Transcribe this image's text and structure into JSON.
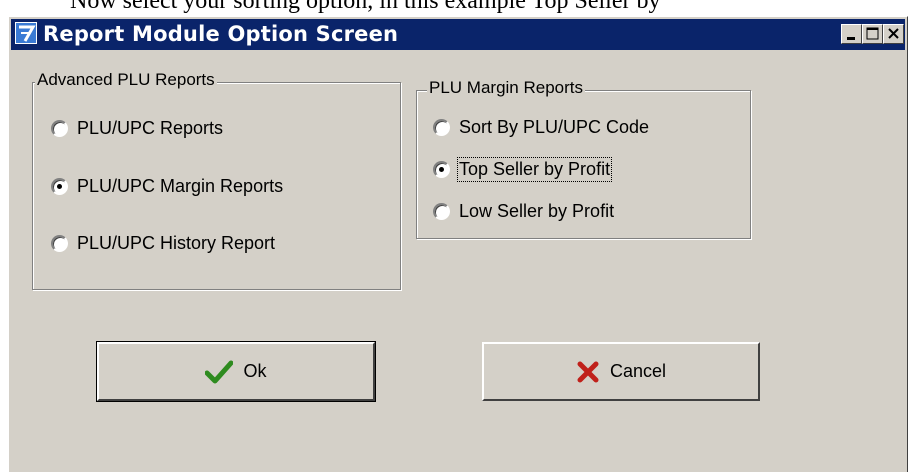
{
  "page_caption": "Now select your sorting option, in this example Top Seller by",
  "window": {
    "title": "Report Module Option Screen",
    "app_icon": "7-app-icon",
    "controls": [
      "minimize-icon",
      "maximize-icon",
      "close-icon"
    ]
  },
  "advanced_group": {
    "title": "Advanced PLU Reports",
    "options": [
      {
        "label": "PLU/UPC Reports",
        "checked": false
      },
      {
        "label": "PLU/UPC Margin Reports",
        "checked": true
      },
      {
        "label": "PLU/UPC History Report",
        "checked": false
      }
    ]
  },
  "margin_group": {
    "title": "PLU Margin Reports",
    "options": [
      {
        "label": "Sort By PLU/UPC Code",
        "checked": false
      },
      {
        "label": "Top Seller by Profit",
        "checked": true
      },
      {
        "label": "Low Seller by Profit",
        "checked": false
      }
    ]
  },
  "buttons": {
    "ok": {
      "label": "Ok",
      "icon": "checkmark-icon",
      "color": "#2e8b1f"
    },
    "cancel": {
      "label": "Cancel",
      "icon": "x-icon",
      "color": "#c0201a"
    }
  },
  "colors": {
    "titlebar": "#0a246a",
    "face": "#d4d0c8"
  }
}
